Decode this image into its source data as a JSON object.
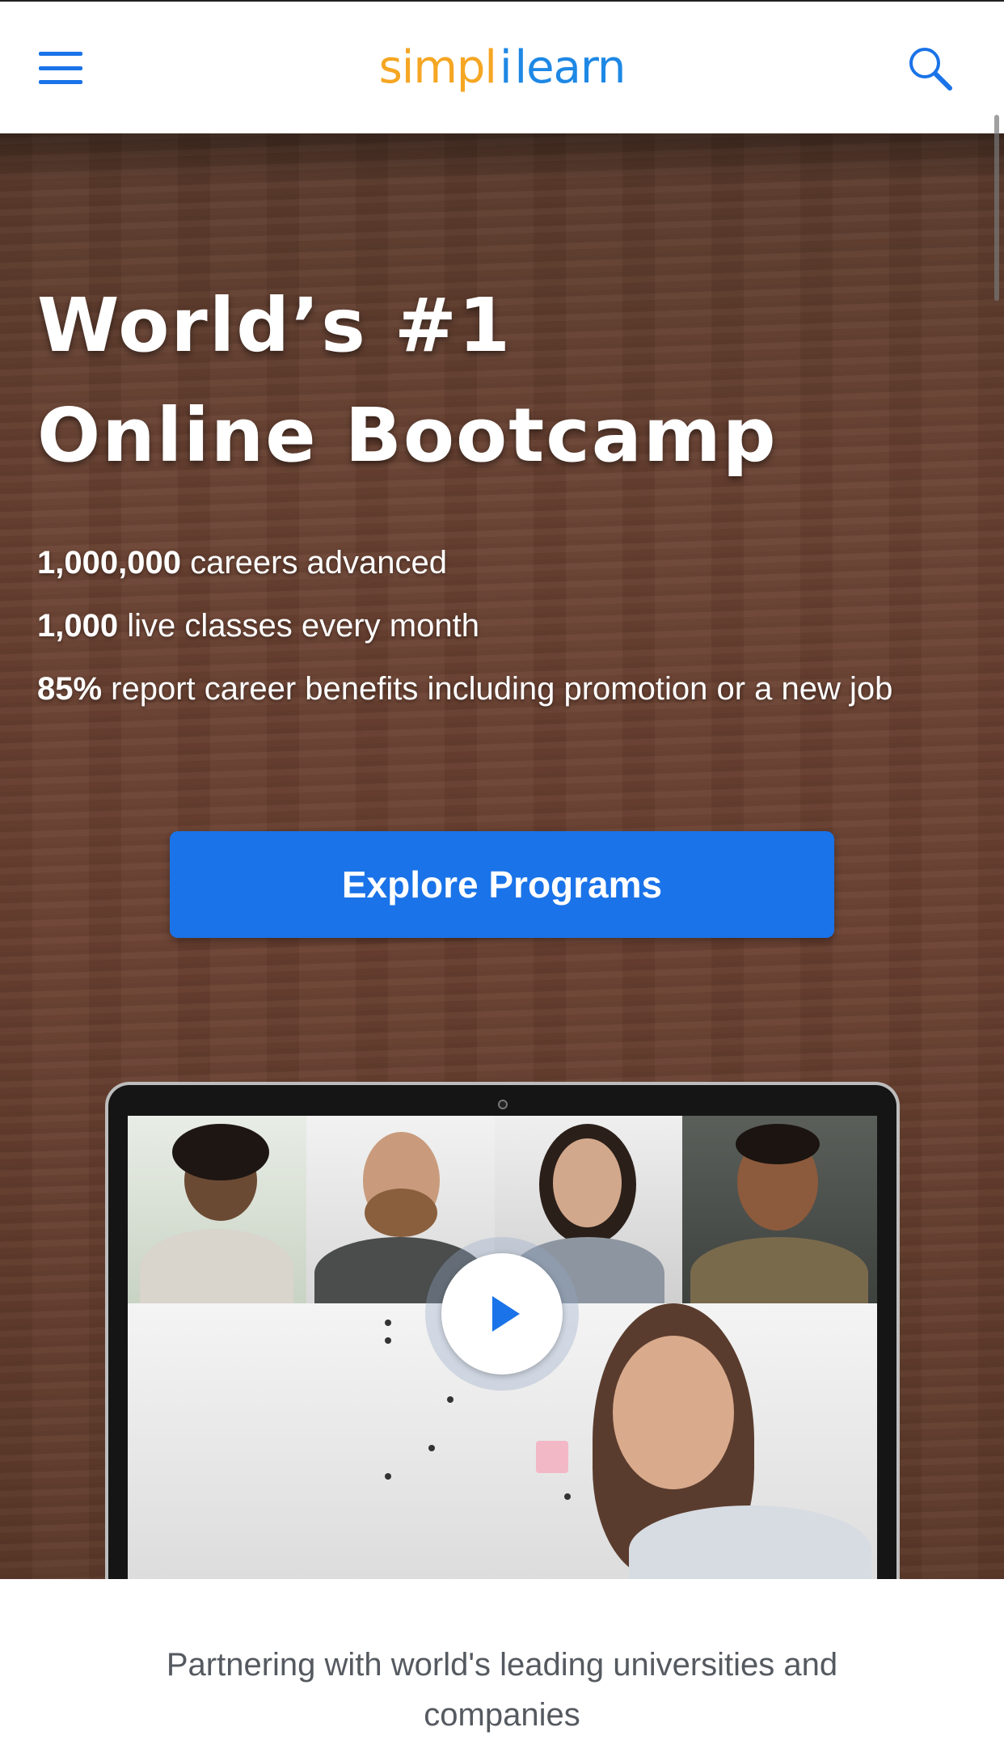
{
  "header": {
    "logo": {
      "part1": "simpl",
      "separator": "i",
      "part2": "learn"
    },
    "menu_icon": "hamburger-menu-icon",
    "search_icon": "search-icon",
    "accent_color": "#1a73e8"
  },
  "hero": {
    "title_line1": "World’s #1",
    "title_line2": "Online Bootcamp",
    "stats": [
      {
        "value": "1,000,000",
        "label": " careers advanced"
      },
      {
        "value": "1,000",
        "label": " live classes every month"
      },
      {
        "value": "85%",
        "label": " report career benefits including promotion or a new job"
      }
    ],
    "cta_label": "Explore Programs",
    "video_play_icon": "play-icon"
  },
  "partners": {
    "text": "Partnering with world's leading universities and companies"
  }
}
